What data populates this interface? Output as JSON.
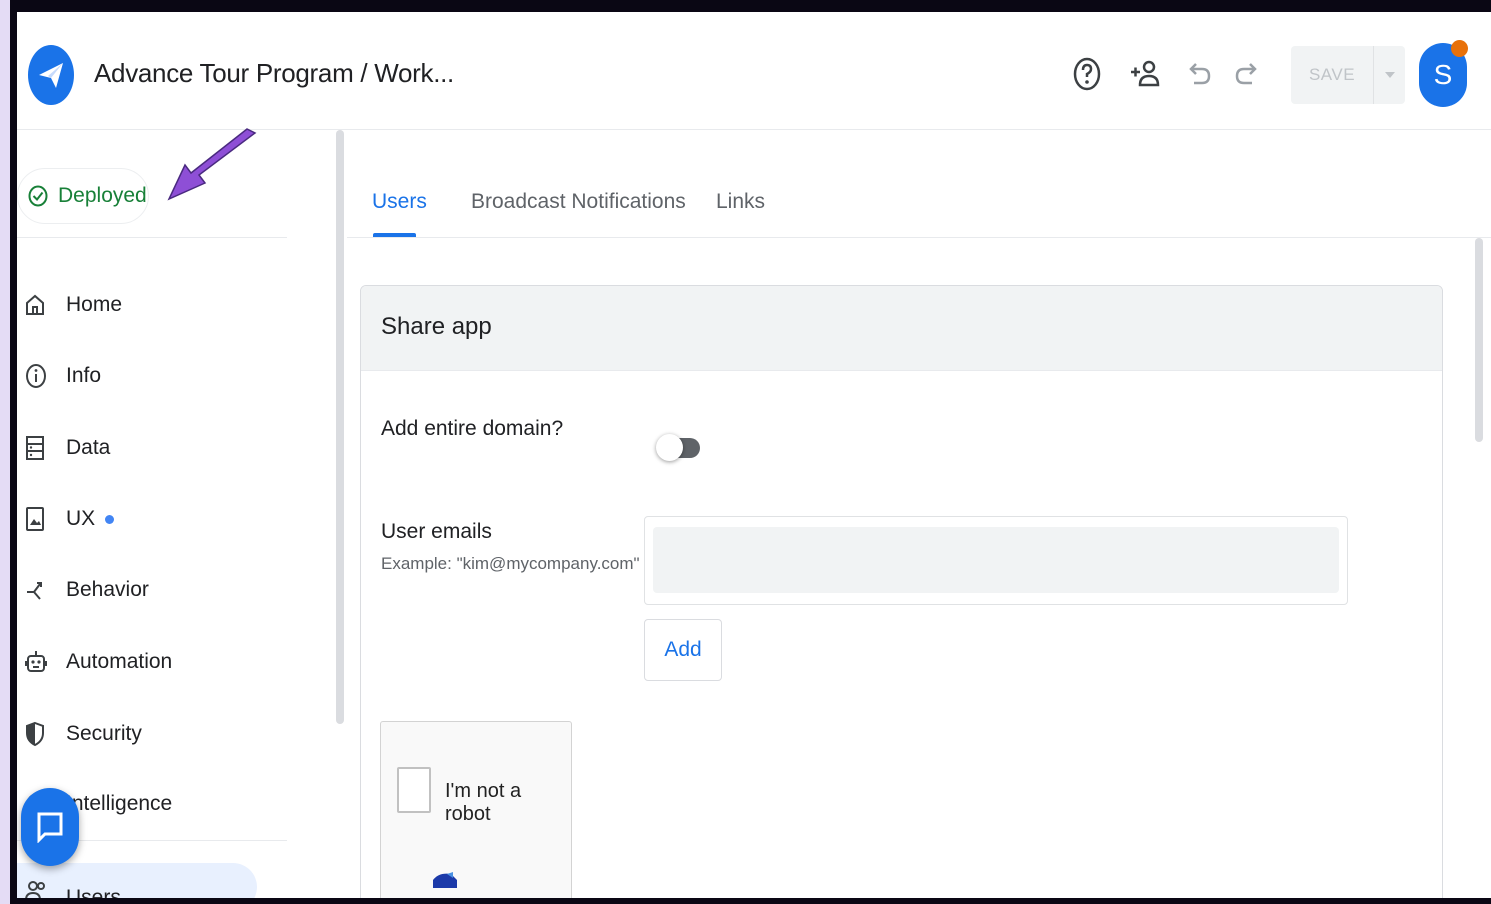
{
  "header": {
    "title": "Advance Tour Program / Work...",
    "logo_icon": "paper-plane-icon",
    "help_icon": "help-circle-icon",
    "share_icon": "add-person-icon",
    "undo_icon": "undo-icon",
    "redo_icon": "redo-icon",
    "save_label": "SAVE",
    "avatar_letter": "S"
  },
  "sidebar": {
    "status": "Deployed",
    "items": [
      {
        "label": "Home",
        "icon": "home-icon"
      },
      {
        "label": "Info",
        "icon": "info-icon"
      },
      {
        "label": "Data",
        "icon": "data-icon"
      },
      {
        "label": "UX",
        "icon": "ux-icon"
      },
      {
        "label": "Behavior",
        "icon": "behavior-icon"
      },
      {
        "label": "Automation",
        "icon": "robot-icon"
      },
      {
        "label": "Security",
        "icon": "shield-icon"
      },
      {
        "label": "Intelligence",
        "icon": "intelligence-icon"
      }
    ],
    "selected_item": "Users"
  },
  "main": {
    "tabs": [
      {
        "label": "Users",
        "active": true
      },
      {
        "label": "Broadcast Notifications",
        "active": false
      },
      {
        "label": "Links",
        "active": false
      }
    ],
    "card": {
      "title": "Share app",
      "domain_label": "Add entire domain?",
      "domain_toggle": false,
      "emails_label": "User emails",
      "emails_hint": "Example: \"kim@mycompany.com\"",
      "emails_value": "",
      "add_label": "Add",
      "captcha_label": "I'm not a robot"
    }
  },
  "colors": {
    "accent": "#1a73e8",
    "deployed": "#188038",
    "avatar_badge": "#e8710a",
    "annotation_arrow": "#8e4fd6"
  }
}
